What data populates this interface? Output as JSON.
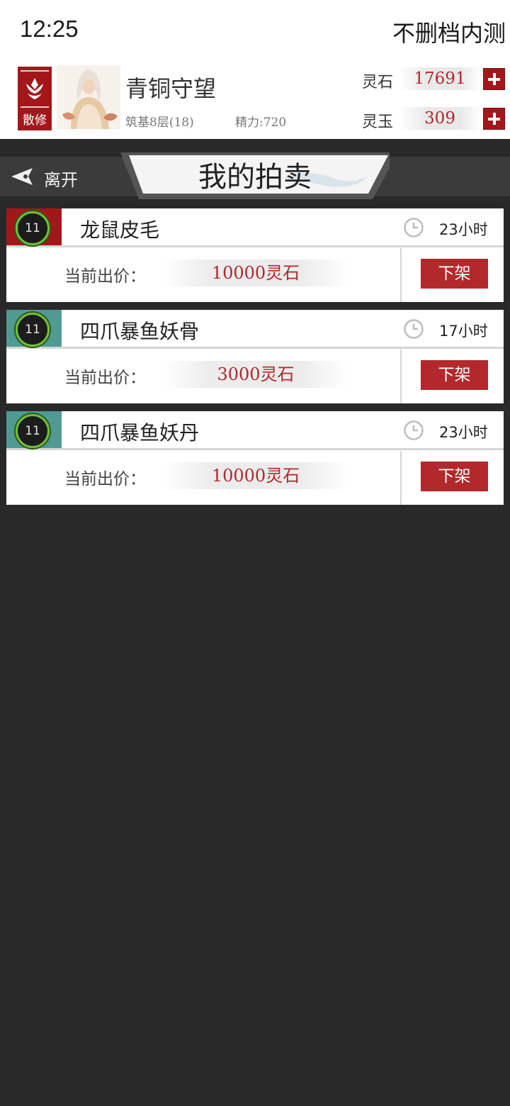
{
  "status_bar": {
    "time": "12:25",
    "right_text": "不删档内测"
  },
  "profile": {
    "rank_label": "散修",
    "name": "青铜守望",
    "realm": "筑基8层(18)",
    "energy": "精力:720"
  },
  "currencies": [
    {
      "label": "灵石",
      "value": "17691"
    },
    {
      "label": "灵玉",
      "value": "309"
    }
  ],
  "nav": {
    "back_label": "离开",
    "title": "我的拍卖"
  },
  "listings": [
    {
      "level": "11",
      "name": "龙鼠皮毛",
      "time_left": "23小时",
      "bid_label": "当前出价：",
      "bid": "10000灵石",
      "action": "下架",
      "quality_color": "#a3171b"
    },
    {
      "level": "11",
      "name": "四爪暴鱼妖骨",
      "time_left": "17小时",
      "bid_label": "当前出价：",
      "bid": "3000灵石",
      "action": "下架",
      "quality_color": "#4f9a92"
    },
    {
      "level": "11",
      "name": "四爪暴鱼妖丹",
      "time_left": "23小时",
      "bid_label": "当前出价：",
      "bid": "10000灵石",
      "action": "下架",
      "quality_color": "#4f9a92"
    }
  ],
  "colors": {
    "accent_red": "#a3171b",
    "price_red": "#b0282c",
    "background": "#292929"
  }
}
